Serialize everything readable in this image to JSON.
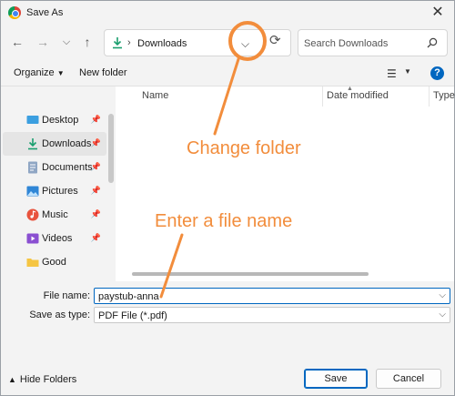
{
  "window": {
    "title": "Save As"
  },
  "nav": {
    "back_icon": "arrow-left-icon",
    "forward_icon": "arrow-right-icon",
    "recent_icon": "chevron-down-icon",
    "up_icon": "arrow-up-icon",
    "address_path": "Downloads",
    "refresh_icon": "refresh-icon",
    "search_placeholder": "Search Downloads"
  },
  "toolbar": {
    "organize_label": "Organize",
    "new_folder_label": "New folder"
  },
  "columns": {
    "name": "Name",
    "date_modified": "Date modified",
    "type": "Type"
  },
  "sidebar": {
    "items": [
      {
        "label": "Desktop",
        "icon": "desktop-icon",
        "pinned": true
      },
      {
        "label": "Downloads",
        "icon": "download-icon",
        "pinned": true,
        "selected": true
      },
      {
        "label": "Documents",
        "icon": "documents-icon",
        "pinned": true
      },
      {
        "label": "Pictures",
        "icon": "pictures-icon",
        "pinned": true
      },
      {
        "label": "Music",
        "icon": "music-icon",
        "pinned": true
      },
      {
        "label": "Videos",
        "icon": "videos-icon",
        "pinned": true
      },
      {
        "label": "Good",
        "icon": "folder-icon",
        "pinned": false
      }
    ]
  },
  "form": {
    "file_name_label": "File name:",
    "file_name_value": "paystub-anna",
    "save_as_type_label": "Save as type:",
    "save_as_type_value": "PDF File (*.pdf)"
  },
  "footer": {
    "hide_folders_label": "Hide Folders",
    "save_label": "Save",
    "cancel_label": "Cancel"
  },
  "annotations": {
    "change_folder": "Change folder",
    "enter_file_name": "Enter a file name",
    "color": "#f28d3c"
  },
  "colors": {
    "accent": "#0067c0",
    "download_green": "#1a9e6e"
  }
}
